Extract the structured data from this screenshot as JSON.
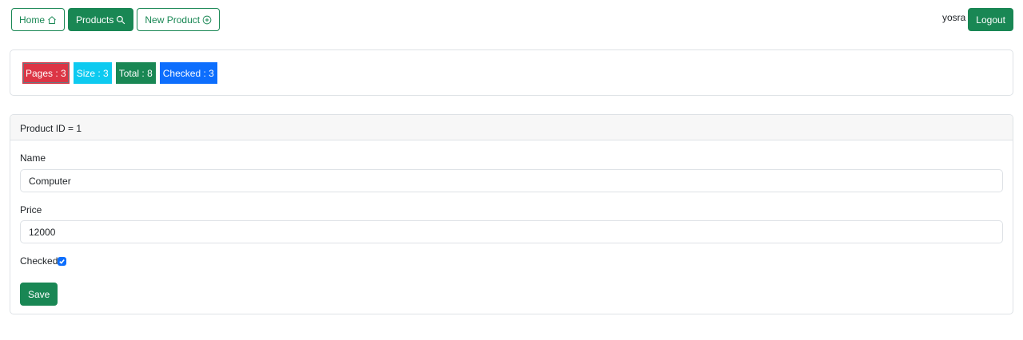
{
  "nav": {
    "home_label": "Home",
    "products_label": "Products",
    "new_product_label": "New Product"
  },
  "user": {
    "username": "yosra",
    "logout_label": "Logout"
  },
  "stats": {
    "pages": "Pages : 3",
    "size": "Size : 3",
    "total": "Total : 8",
    "checked": "Checked : 3"
  },
  "product_form": {
    "header": "Product ID = 1",
    "name_label": "Name",
    "name_value": "Computer",
    "price_label": "Price",
    "price_value": "12000",
    "checked_label": "Checked",
    "checked_value": true,
    "save_label": "Save"
  },
  "colors": {
    "success": "#198754",
    "danger": "#dc3545",
    "info": "#0dcaf0",
    "primary": "#0d6efd"
  },
  "icons": {
    "home": "house-icon",
    "products": "search-icon",
    "new_product": "plus-circle-icon",
    "checkbox": "check-icon"
  }
}
